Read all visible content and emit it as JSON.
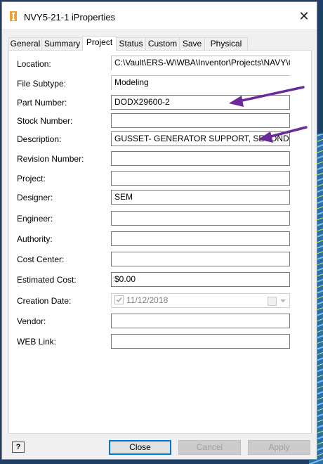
{
  "window": {
    "title": "NVY5-21-1 iProperties",
    "close_glyph": "✕",
    "app_icon": "inventor-document-icon",
    "app_icon_color": "#f0a030"
  },
  "tabs": [
    {
      "label": "General"
    },
    {
      "label": "Summary"
    },
    {
      "label": "Project",
      "active": true
    },
    {
      "label": "Status"
    },
    {
      "label": "Custom"
    },
    {
      "label": "Save"
    },
    {
      "label": "Physical"
    }
  ],
  "fields": {
    "location": {
      "label": "Location:",
      "value": "C:\\Vault\\ERS-W\\WBA\\Inventor\\Projects\\NAVY\\Gene"
    },
    "file_subtype": {
      "label": "File Subtype:",
      "value": "Modeling"
    },
    "part_number": {
      "label": "Part Number:",
      "value": "DODX29600-2"
    },
    "stock_number": {
      "label": "Stock Number:",
      "value": ""
    },
    "description": {
      "label": "Description:",
      "value": "GUSSET- GENERATOR SUPPORT, SECOND"
    },
    "revision_number": {
      "label": "Revision Number:",
      "value": ""
    },
    "project": {
      "label": "Project:",
      "value": ""
    },
    "designer": {
      "label": "Designer:",
      "value": "SEM"
    },
    "engineer": {
      "label": "Engineer:",
      "value": ""
    },
    "authority": {
      "label": "Authority:",
      "value": ""
    },
    "cost_center": {
      "label": "Cost Center:",
      "value": ""
    },
    "estimated_cost": {
      "label": "Estimated Cost:",
      "value": "$0.00"
    },
    "creation_date": {
      "label": "Creation Date:",
      "value": "11/12/2018",
      "checked": true
    },
    "vendor": {
      "label": "Vendor:",
      "value": ""
    },
    "web_link": {
      "label": "WEB Link:",
      "value": ""
    }
  },
  "annotation_color": "#6a2a9a",
  "buttons": {
    "help": "?",
    "close": "Close",
    "cancel": "Cancel",
    "apply": "Apply"
  }
}
